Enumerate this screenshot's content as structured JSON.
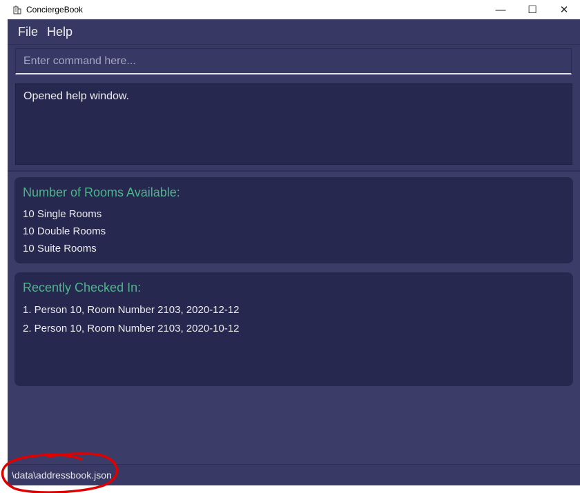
{
  "window": {
    "title": "ConciergeBook",
    "app_icon": "building-icon",
    "controls": [
      "minimize-icon",
      "maximize-icon",
      "close-icon"
    ],
    "minimize_glyph": "—",
    "maximize_glyph": "☐",
    "close_glyph": "✕"
  },
  "menu": {
    "items": [
      {
        "label": "File"
      },
      {
        "label": "Help"
      }
    ]
  },
  "command": {
    "value": "",
    "placeholder": "Enter command here..."
  },
  "result": {
    "text": "Opened help window."
  },
  "rooms": {
    "title": "Number of Rooms Available:",
    "lines": [
      "10 Single Rooms",
      "10 Double Rooms",
      "10 Suite Rooms"
    ]
  },
  "checkins": {
    "title": "Recently Checked In:",
    "lines": [
      "1. Person 10, Room Number 2103, 2020-12-12",
      "2. Person 10, Room Number 2103, 2020-10-12"
    ]
  },
  "status": {
    "path": "\\data\\addressbook.json"
  },
  "colors": {
    "background": "#3b3c68",
    "card": "#262850",
    "card_title": "#4db58a",
    "text": "#ececec",
    "annotation": "#e00000"
  }
}
